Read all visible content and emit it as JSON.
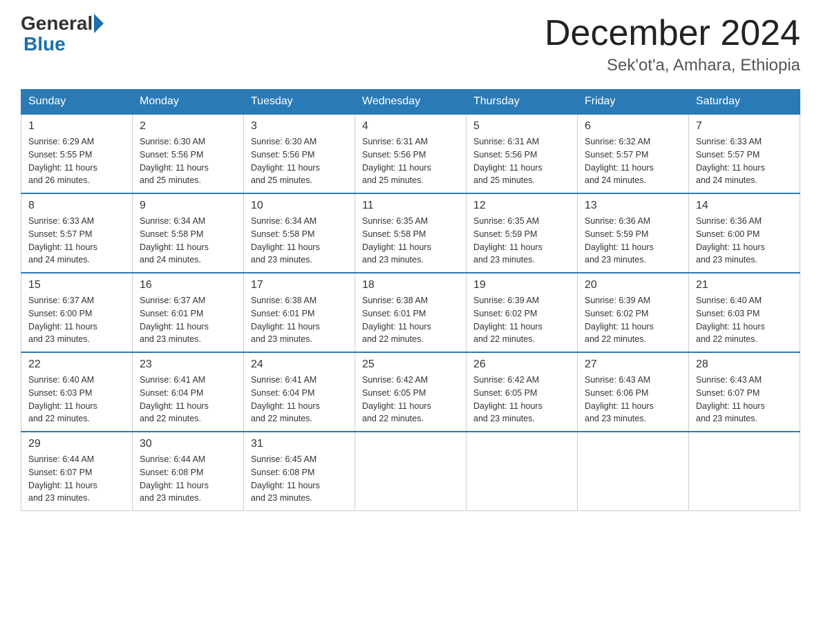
{
  "header": {
    "logo_general": "General",
    "logo_blue": "Blue",
    "month_title": "December 2024",
    "location": "Sek'ot'a, Amhara, Ethiopia"
  },
  "days_of_week": [
    "Sunday",
    "Monday",
    "Tuesday",
    "Wednesday",
    "Thursday",
    "Friday",
    "Saturday"
  ],
  "weeks": [
    [
      {
        "day": "1",
        "sunrise": "6:29 AM",
        "sunset": "5:55 PM",
        "daylight": "11 hours and 26 minutes."
      },
      {
        "day": "2",
        "sunrise": "6:30 AM",
        "sunset": "5:56 PM",
        "daylight": "11 hours and 25 minutes."
      },
      {
        "day": "3",
        "sunrise": "6:30 AM",
        "sunset": "5:56 PM",
        "daylight": "11 hours and 25 minutes."
      },
      {
        "day": "4",
        "sunrise": "6:31 AM",
        "sunset": "5:56 PM",
        "daylight": "11 hours and 25 minutes."
      },
      {
        "day": "5",
        "sunrise": "6:31 AM",
        "sunset": "5:56 PM",
        "daylight": "11 hours and 25 minutes."
      },
      {
        "day": "6",
        "sunrise": "6:32 AM",
        "sunset": "5:57 PM",
        "daylight": "11 hours and 24 minutes."
      },
      {
        "day": "7",
        "sunrise": "6:33 AM",
        "sunset": "5:57 PM",
        "daylight": "11 hours and 24 minutes."
      }
    ],
    [
      {
        "day": "8",
        "sunrise": "6:33 AM",
        "sunset": "5:57 PM",
        "daylight": "11 hours and 24 minutes."
      },
      {
        "day": "9",
        "sunrise": "6:34 AM",
        "sunset": "5:58 PM",
        "daylight": "11 hours and 24 minutes."
      },
      {
        "day": "10",
        "sunrise": "6:34 AM",
        "sunset": "5:58 PM",
        "daylight": "11 hours and 23 minutes."
      },
      {
        "day": "11",
        "sunrise": "6:35 AM",
        "sunset": "5:58 PM",
        "daylight": "11 hours and 23 minutes."
      },
      {
        "day": "12",
        "sunrise": "6:35 AM",
        "sunset": "5:59 PM",
        "daylight": "11 hours and 23 minutes."
      },
      {
        "day": "13",
        "sunrise": "6:36 AM",
        "sunset": "5:59 PM",
        "daylight": "11 hours and 23 minutes."
      },
      {
        "day": "14",
        "sunrise": "6:36 AM",
        "sunset": "6:00 PM",
        "daylight": "11 hours and 23 minutes."
      }
    ],
    [
      {
        "day": "15",
        "sunrise": "6:37 AM",
        "sunset": "6:00 PM",
        "daylight": "11 hours and 23 minutes."
      },
      {
        "day": "16",
        "sunrise": "6:37 AM",
        "sunset": "6:01 PM",
        "daylight": "11 hours and 23 minutes."
      },
      {
        "day": "17",
        "sunrise": "6:38 AM",
        "sunset": "6:01 PM",
        "daylight": "11 hours and 23 minutes."
      },
      {
        "day": "18",
        "sunrise": "6:38 AM",
        "sunset": "6:01 PM",
        "daylight": "11 hours and 22 minutes."
      },
      {
        "day": "19",
        "sunrise": "6:39 AM",
        "sunset": "6:02 PM",
        "daylight": "11 hours and 22 minutes."
      },
      {
        "day": "20",
        "sunrise": "6:39 AM",
        "sunset": "6:02 PM",
        "daylight": "11 hours and 22 minutes."
      },
      {
        "day": "21",
        "sunrise": "6:40 AM",
        "sunset": "6:03 PM",
        "daylight": "11 hours and 22 minutes."
      }
    ],
    [
      {
        "day": "22",
        "sunrise": "6:40 AM",
        "sunset": "6:03 PM",
        "daylight": "11 hours and 22 minutes."
      },
      {
        "day": "23",
        "sunrise": "6:41 AM",
        "sunset": "6:04 PM",
        "daylight": "11 hours and 22 minutes."
      },
      {
        "day": "24",
        "sunrise": "6:41 AM",
        "sunset": "6:04 PM",
        "daylight": "11 hours and 22 minutes."
      },
      {
        "day": "25",
        "sunrise": "6:42 AM",
        "sunset": "6:05 PM",
        "daylight": "11 hours and 22 minutes."
      },
      {
        "day": "26",
        "sunrise": "6:42 AM",
        "sunset": "6:05 PM",
        "daylight": "11 hours and 23 minutes."
      },
      {
        "day": "27",
        "sunrise": "6:43 AM",
        "sunset": "6:06 PM",
        "daylight": "11 hours and 23 minutes."
      },
      {
        "day": "28",
        "sunrise": "6:43 AM",
        "sunset": "6:07 PM",
        "daylight": "11 hours and 23 minutes."
      }
    ],
    [
      {
        "day": "29",
        "sunrise": "6:44 AM",
        "sunset": "6:07 PM",
        "daylight": "11 hours and 23 minutes."
      },
      {
        "day": "30",
        "sunrise": "6:44 AM",
        "sunset": "6:08 PM",
        "daylight": "11 hours and 23 minutes."
      },
      {
        "day": "31",
        "sunrise": "6:45 AM",
        "sunset": "6:08 PM",
        "daylight": "11 hours and 23 minutes."
      },
      null,
      null,
      null,
      null
    ]
  ],
  "sunrise_label": "Sunrise:",
  "sunset_label": "Sunset:",
  "daylight_label": "Daylight:"
}
